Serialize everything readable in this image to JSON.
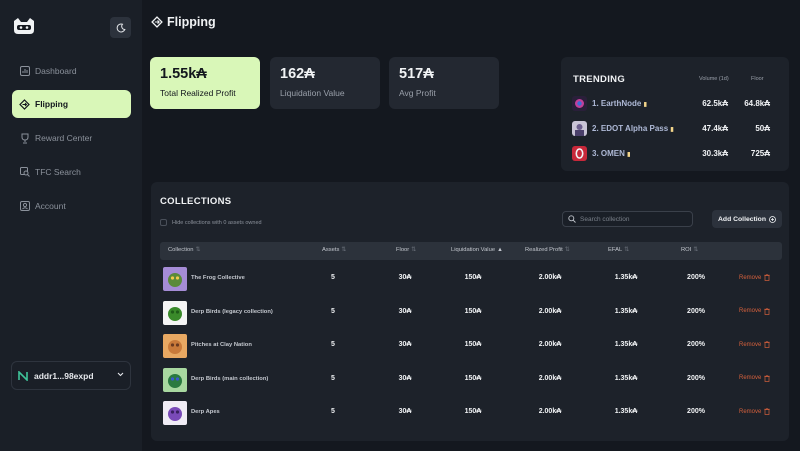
{
  "sidebar": {
    "items": [
      {
        "label": "Dashboard",
        "icon": "dashboard-icon"
      },
      {
        "label": "Flipping",
        "icon": "flip-icon",
        "active": true
      },
      {
        "label": "Reward Center",
        "icon": "trophy-icon"
      },
      {
        "label": "TFC Search",
        "icon": "tfc-search-icon"
      },
      {
        "label": "Account",
        "icon": "account-icon"
      }
    ],
    "wallet": {
      "address": "addr1...98expd"
    }
  },
  "header": {
    "title": "Flipping"
  },
  "stats": [
    {
      "value": "1.55k₳",
      "label": "Total Realized Profit"
    },
    {
      "value": "162₳",
      "label": "Liquidation Value"
    },
    {
      "value": "517₳",
      "label": "Avg Profit"
    }
  ],
  "trending": {
    "title": "TRENDING",
    "headers": {
      "volume": "Volume (1d)",
      "floor": "Floor"
    },
    "items": [
      {
        "name": "1. EarthNode",
        "volume": "62.5k₳",
        "floor": "64.8k₳"
      },
      {
        "name": "2. EDOT Alpha Pass",
        "volume": "47.4k₳",
        "floor": "50₳"
      },
      {
        "name": "3. OMEN",
        "volume": "30.3k₳",
        "floor": "725₳"
      }
    ]
  },
  "collections": {
    "title": "COLLECTIONS",
    "hide_label": "Hide collections with 0 assets owned",
    "search_placeholder": "Search collection",
    "add_label": "Add Collection",
    "columns": [
      "Collection",
      "Assets",
      "Floor",
      "Liquidation Value",
      "Realized Profit",
      "EFAL",
      "ROI"
    ],
    "remove_label": "Remove",
    "rows": [
      {
        "name": "The Frog Collective",
        "assets": "5",
        "floor": "30₳",
        "liquidation": "150₳",
        "realized": "2.00k₳",
        "efal": "1.35k₳",
        "roi": "200%"
      },
      {
        "name": "Derp Birds (legacy collection)",
        "assets": "5",
        "floor": "30₳",
        "liquidation": "150₳",
        "realized": "2.00k₳",
        "efal": "1.35k₳",
        "roi": "200%"
      },
      {
        "name": "Pitches at Clay Nation",
        "assets": "5",
        "floor": "30₳",
        "liquidation": "150₳",
        "realized": "2.00k₳",
        "efal": "1.35k₳",
        "roi": "200%"
      },
      {
        "name": "Derp Birds (main collection)",
        "assets": "5",
        "floor": "30₳",
        "liquidation": "150₳",
        "realized": "2.00k₳",
        "efal": "1.35k₳",
        "roi": "200%"
      },
      {
        "name": "Derp Apes",
        "assets": "5",
        "floor": "30₳",
        "liquidation": "150₳",
        "realized": "2.00k₳",
        "efal": "1.35k₳",
        "roi": "200%"
      }
    ]
  },
  "colors": {
    "accent": "#d9f7b8",
    "danger": "#d4603c",
    "background": "#14181f"
  }
}
